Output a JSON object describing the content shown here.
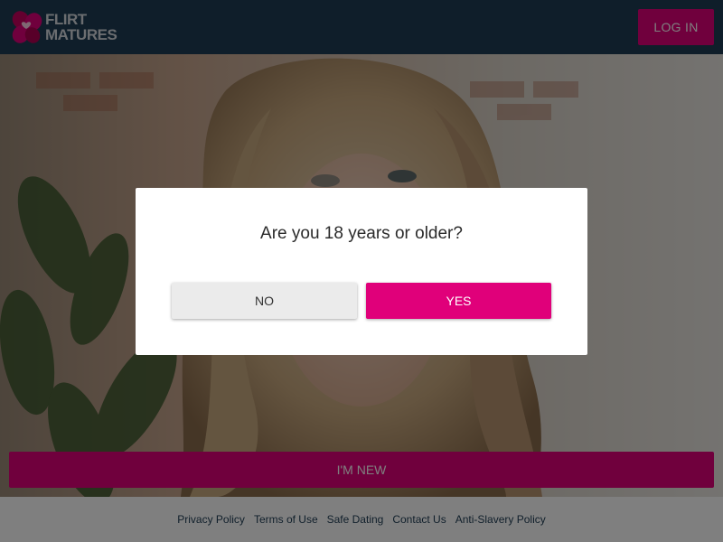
{
  "brand": {
    "logo_line1": "FLIRT",
    "logo_line2": "MATURES",
    "logo_icon": "heart-clover-icon",
    "accent_color": "#e0007a",
    "header_color": "#1f3d55"
  },
  "header": {
    "login_label": "LOG IN"
  },
  "hero": {
    "signup_label": "I'M NEW"
  },
  "age_modal": {
    "question": "Are you 18 years or older?",
    "no_label": "NO",
    "yes_label": "YES"
  },
  "footer": {
    "links": [
      "Privacy Policy",
      "Terms of Use",
      "Safe Dating",
      "Contact Us",
      "Anti-Slavery Policy"
    ]
  }
}
